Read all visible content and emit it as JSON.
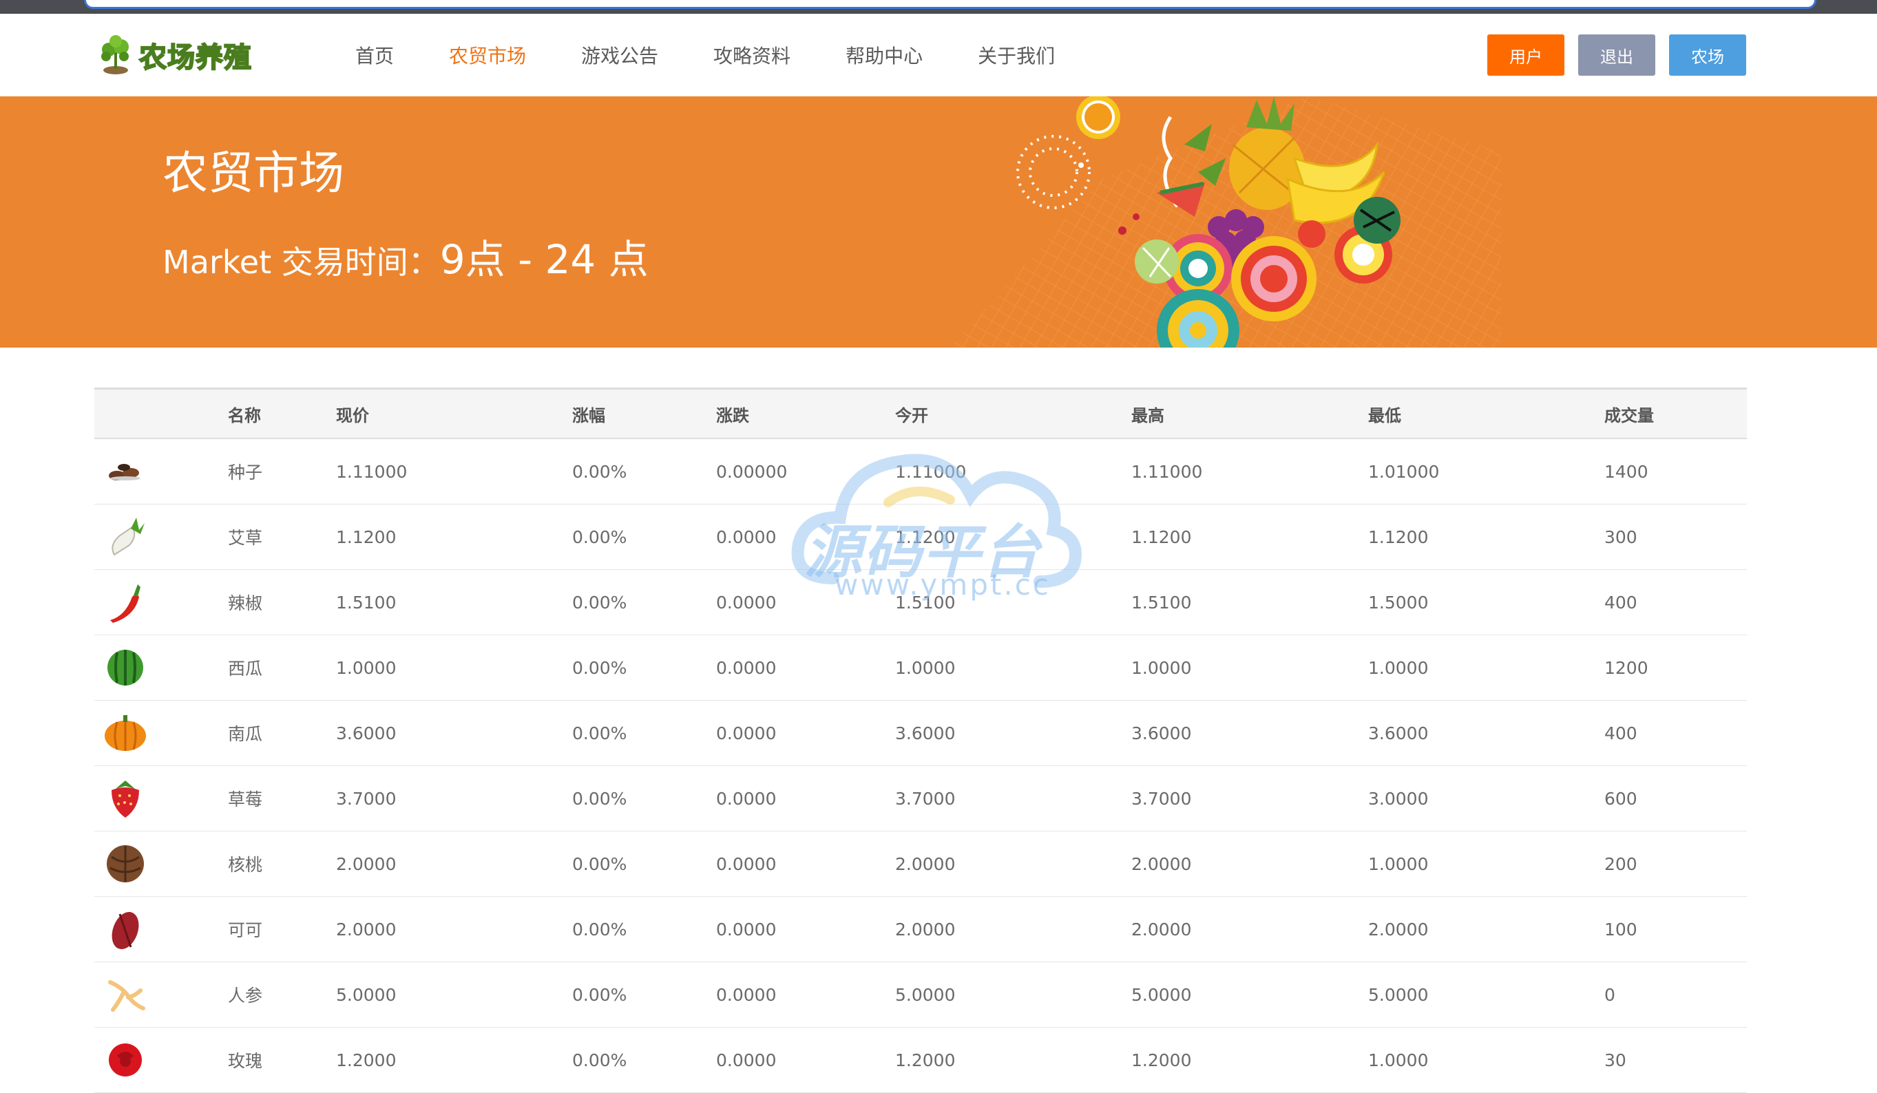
{
  "logo": {
    "text": "农场养殖"
  },
  "nav": {
    "links": [
      "首页",
      "农贸市场",
      "游戏公告",
      "攻略资料",
      "帮助中心",
      "关于我们"
    ],
    "active_index": 1
  },
  "buttons": {
    "user": "用户",
    "logout": "退出",
    "farm": "农场"
  },
  "banner": {
    "title": "农贸市场",
    "subtitle_prefix": "Market 交易时间：",
    "subtitle_hours": "9点 - 24 点"
  },
  "table": {
    "headers": [
      "名称",
      "现价",
      "涨幅",
      "涨跌",
      "今开",
      "最高",
      "最低",
      "成交量"
    ],
    "rows": [
      {
        "icon": "seed-icon",
        "name": "种子",
        "price": "1.11000",
        "change": "0.00%",
        "diff": "0.00000",
        "open": "1.11000",
        "high": "1.11000",
        "low": "1.01000",
        "volume": "1400"
      },
      {
        "icon": "radish-icon",
        "name": "艾草",
        "price": "1.1200",
        "change": "0.00%",
        "diff": "0.0000",
        "open": "1.1200",
        "high": "1.1200",
        "low": "1.1200",
        "volume": "300"
      },
      {
        "icon": "chili-icon",
        "name": "辣椒",
        "price": "1.5100",
        "change": "0.00%",
        "diff": "0.0000",
        "open": "1.5100",
        "high": "1.5100",
        "low": "1.5000",
        "volume": "400"
      },
      {
        "icon": "watermelon-icon",
        "name": "西瓜",
        "price": "1.0000",
        "change": "0.00%",
        "diff": "0.0000",
        "open": "1.0000",
        "high": "1.0000",
        "low": "1.0000",
        "volume": "1200"
      },
      {
        "icon": "pumpkin-icon",
        "name": "南瓜",
        "price": "3.6000",
        "change": "0.00%",
        "diff": "0.0000",
        "open": "3.6000",
        "high": "3.6000",
        "low": "3.6000",
        "volume": "400"
      },
      {
        "icon": "strawberry-icon",
        "name": "草莓",
        "price": "3.7000",
        "change": "0.00%",
        "diff": "0.0000",
        "open": "3.7000",
        "high": "3.7000",
        "low": "3.0000",
        "volume": "600"
      },
      {
        "icon": "walnut-icon",
        "name": "核桃",
        "price": "2.0000",
        "change": "0.00%",
        "diff": "0.0000",
        "open": "2.0000",
        "high": "2.0000",
        "low": "1.0000",
        "volume": "200"
      },
      {
        "icon": "cocoa-icon",
        "name": "可可",
        "price": "2.0000",
        "change": "0.00%",
        "diff": "0.0000",
        "open": "2.0000",
        "high": "2.0000",
        "low": "2.0000",
        "volume": "100"
      },
      {
        "icon": "ginseng-icon",
        "name": "人参",
        "price": "5.0000",
        "change": "0.00%",
        "diff": "0.0000",
        "open": "5.0000",
        "high": "5.0000",
        "low": "5.0000",
        "volume": "0"
      },
      {
        "icon": "rose-icon",
        "name": "玫瑰",
        "price": "1.2000",
        "change": "0.00%",
        "diff": "0.0000",
        "open": "1.2000",
        "high": "1.2000",
        "low": "1.0000",
        "volume": "30"
      }
    ]
  },
  "watermark": {
    "title": "源码平台",
    "url": "www.ympt.cc"
  },
  "colors": {
    "accent": "#f07213",
    "banner": "#ec8530",
    "user_button": "#ff6a00",
    "logout_button": "#8b95ad",
    "farm_button": "#4d9fe0"
  }
}
